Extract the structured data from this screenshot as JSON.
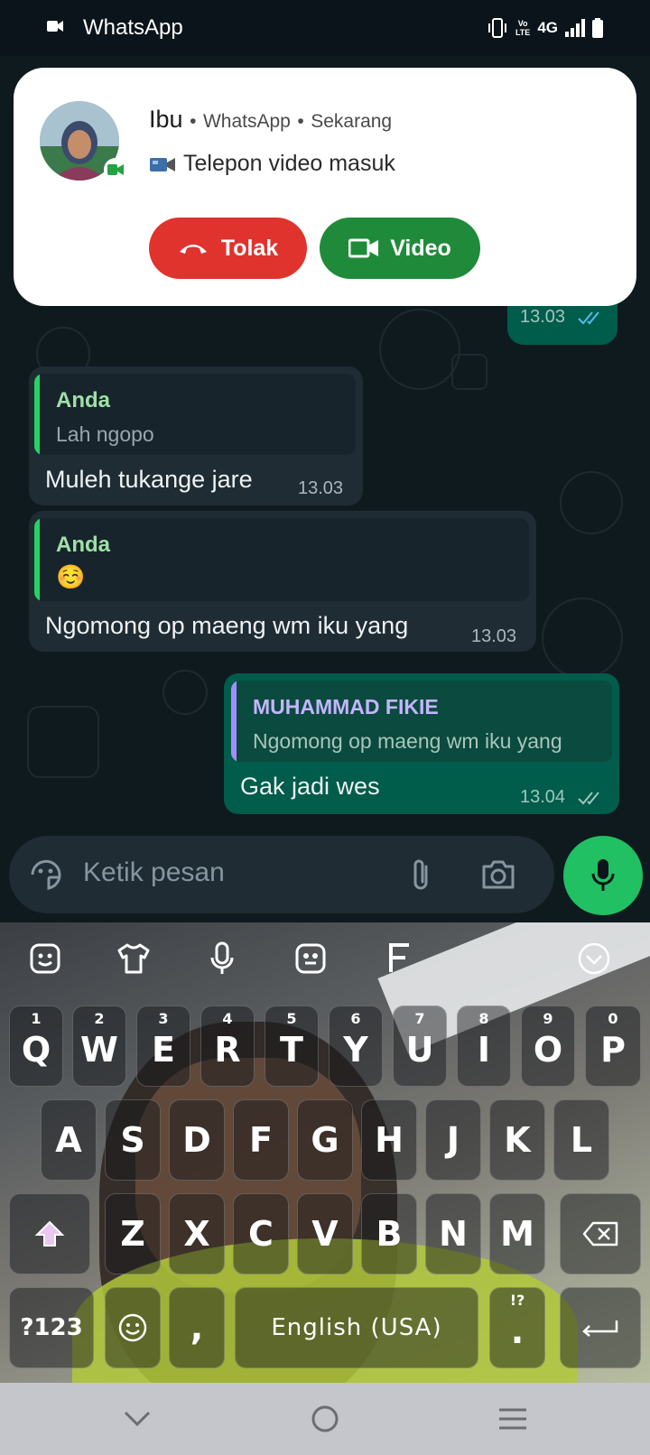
{
  "status_bar": {
    "app_name": "WhatsApp",
    "network": "4G",
    "volte": "Vo\nLTE"
  },
  "notification": {
    "caller_name": "Ibu",
    "app": "WhatsApp",
    "time": "Sekarang",
    "separator": "•",
    "description_icon": "video-camera-icon",
    "description": "Telepon video masuk",
    "decline_label": "Tolak",
    "accept_label": "Video",
    "colors": {
      "decline": "#e0332d",
      "accept": "#1f8b3a"
    }
  },
  "chat": {
    "partial_bubble_time": "13.03",
    "messages": [
      {
        "quote_name": "Anda",
        "quote_text": "Lah ngopo",
        "text": "Muleh tukange jare",
        "time": "13.03"
      },
      {
        "quote_name": "Anda",
        "quote_text": "☺️",
        "text": "Ngomong op maeng wm iku yang",
        "time": "13.03"
      },
      {
        "quote_name": "MUHAMMAD FIKIE",
        "quote_text": "Ngomong op maeng wm iku yang",
        "text": "Gak jadi wes",
        "time": "13.04"
      }
    ]
  },
  "input": {
    "placeholder": "Ketik pesan"
  },
  "keyboard": {
    "row1": [
      {
        "hint": "1",
        "key": "Q"
      },
      {
        "hint": "2",
        "key": "W"
      },
      {
        "hint": "3",
        "key": "E"
      },
      {
        "hint": "4",
        "key": "R"
      },
      {
        "hint": "5",
        "key": "T"
      },
      {
        "hint": "6",
        "key": "Y"
      },
      {
        "hint": "7",
        "key": "U"
      },
      {
        "hint": "8",
        "key": "I"
      },
      {
        "hint": "9",
        "key": "O"
      },
      {
        "hint": "0",
        "key": "P"
      }
    ],
    "row2": [
      "A",
      "S",
      "D",
      "F",
      "G",
      "H",
      "J",
      "K",
      "L"
    ],
    "row3": [
      "Z",
      "X",
      "C",
      "V",
      "B",
      "N",
      "M"
    ],
    "symbols_label": "?123",
    "comma": ",",
    "space_label": "English (USA)",
    "period_hint": "!?",
    "period": "."
  }
}
